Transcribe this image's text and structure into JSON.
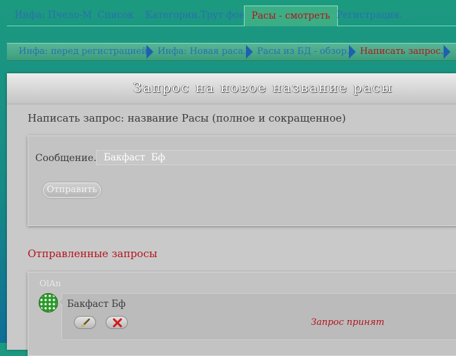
{
  "tabs": [
    {
      "label": "Инфа: Пчело-М"
    },
    {
      "label": "Список"
    },
    {
      "label": "Категории.Трут фон."
    },
    {
      "label": "Расы - смотреть",
      "active": true
    },
    {
      "label": "Регистрация."
    }
  ],
  "breadcrumbs": [
    {
      "label": "Инфа: перед регистрацией."
    },
    {
      "label": "Инфа: Новая раса."
    },
    {
      "label": "Расы из БД - обзор."
    },
    {
      "label": "Написать запрос.",
      "current": true
    }
  ],
  "panel": {
    "title": "Запрос на новое название расы",
    "subtitle": "Написать запрос: название Расы (полное и сокращенное)"
  },
  "form": {
    "message_label": "Сообщение..",
    "message_value": "Бакфаст  Бф",
    "send_label": "Отправить"
  },
  "sent": {
    "title": "Отправленные запросы",
    "items": [
      {
        "author": "OlAn",
        "text": "Бакфаст Бф",
        "status": "Запрос принят"
      }
    ]
  },
  "colors": {
    "accent_red": "#b5121b",
    "link_blue": "#2a6fb0",
    "background_green": "#1c9a80"
  },
  "icons": {
    "edit": "pencil-icon",
    "delete": "x-icon",
    "breadcrumb_separator": "arrow-right-icon"
  }
}
